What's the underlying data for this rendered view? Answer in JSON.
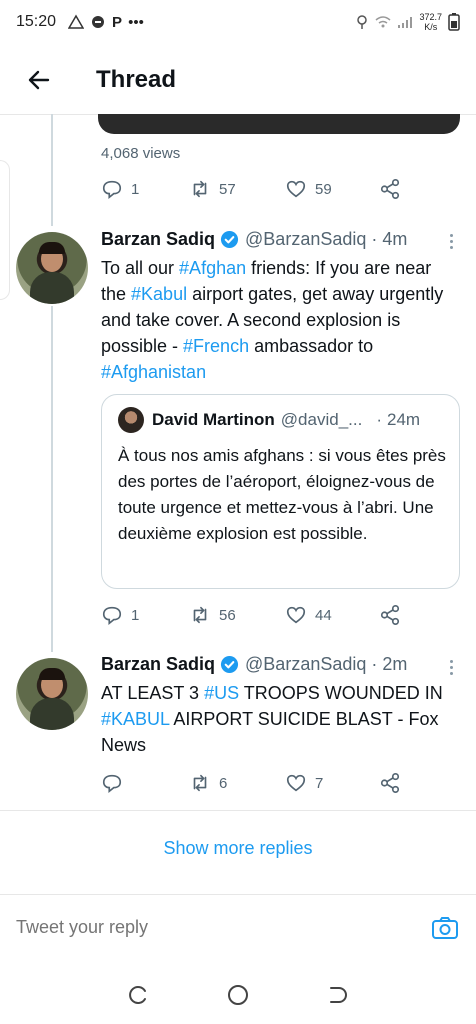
{
  "status_bar": {
    "time": "15:20",
    "letter": "P",
    "dots": "•••",
    "net_speed": "372.7",
    "net_unit": "K/s"
  },
  "header": {
    "title": "Thread",
    "back_icon": "arrow-left-icon"
  },
  "prev_tweet": {
    "views": "4,068 views",
    "replies": "1",
    "retweets": "57",
    "likes": "59"
  },
  "tweets": [
    {
      "name": "Barzan Sadiq",
      "handle": "@BarzanSadiq",
      "separator": "·",
      "time": "4m",
      "text_parts": [
        {
          "t": "To all our ",
          "h": false
        },
        {
          "t": "#Afghan",
          "h": true
        },
        {
          "t": " friends: If you are near the ",
          "h": false
        },
        {
          "t": "#Kabul",
          "h": true
        },
        {
          "t": " airport gates, get away urgently and take cover. A second explosion is possible - ",
          "h": false
        },
        {
          "t": "#French",
          "h": true
        },
        {
          "t": " ambassador to ",
          "h": false
        },
        {
          "t": "#Afghanistan",
          "h": true
        }
      ],
      "quote": {
        "name": "David Martinon",
        "handle": "@david_...",
        "separator": "·",
        "time": "24m",
        "text": "À tous nos amis afghans : si vous êtes près des portes de l’aéroport, éloignez-vous de toute urgence et mettez-vous à l’abri. Une deuxième explosion est possible."
      },
      "replies": "1",
      "retweets": "56",
      "likes": "44"
    },
    {
      "name": "Barzan Sadiq",
      "handle": "@BarzanSadiq",
      "separator": "·",
      "time": "2m",
      "text_parts": [
        {
          "t": "AT LEAST 3 ",
          "h": false
        },
        {
          "t": "#US",
          "h": true
        },
        {
          "t": " TROOPS WOUNDED IN ",
          "h": false
        },
        {
          "t": "#KABUL",
          "h": true
        },
        {
          "t": " AIRPORT SUICIDE BLAST - Fox News",
          "h": false
        }
      ],
      "replies": "",
      "retweets": "6",
      "likes": "7"
    }
  ],
  "show_more": "Show more replies",
  "reply": {
    "placeholder": "Tweet your reply"
  },
  "colors": {
    "accent": "#1d9bf0",
    "text": "#0f1419",
    "muted": "#536471",
    "border": "#e7e7e7"
  }
}
